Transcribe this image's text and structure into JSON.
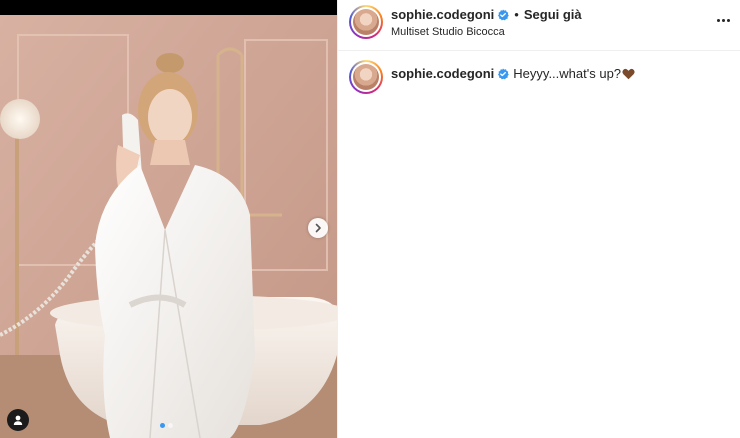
{
  "post": {
    "username": "sophie.codegoni",
    "separator": "•",
    "follow_label": "Segui già",
    "location": "Multiset Studio Bicocca",
    "caption": {
      "username": "sophie.codegoni",
      "text": "Heyyy...what's up?",
      "emoji": "brown-heart"
    },
    "carousel": {
      "total_slides": 2,
      "active_slide": 1
    }
  },
  "colors": {
    "text": "#262626",
    "verified": "#3897f0",
    "border": "#efefef",
    "active_dot": "#3897f0",
    "heart": "#7b4a2a"
  },
  "icons": {
    "verified": "verified-badge-icon",
    "more": "more-options-icon",
    "next": "chevron-right-icon",
    "user_tag": "user-tag-icon"
  }
}
